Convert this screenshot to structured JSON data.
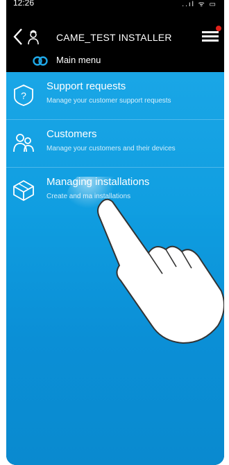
{
  "status": {
    "time": "12:26",
    "icons": "..ıl ᯤ ▭"
  },
  "header": {
    "title": "CAME_TEST INSTALLER",
    "subtitle": "Main menu"
  },
  "menu": [
    {
      "title": "Support requests",
      "desc": "Manage your customer support requests",
      "icon": "question-shield-icon"
    },
    {
      "title": "Customers",
      "desc": "Manage your customers and their devices",
      "icon": "users-icon"
    },
    {
      "title": "Managing installations",
      "desc": "Create and ma     installations",
      "icon": "cube-icon"
    }
  ],
  "colors": {
    "header_bg": "#000000",
    "content_bg": "#1aa6e6",
    "badge": "#e0211a"
  }
}
